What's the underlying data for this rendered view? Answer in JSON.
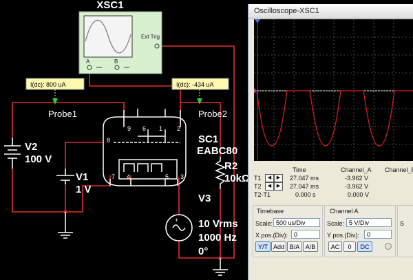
{
  "schematic": {
    "xsc_title": "XSC1",
    "ext_trig_label": "Ext Trig",
    "xsc_a_label": "A",
    "xsc_b_label": "B",
    "probe1_reading": "I(dc): 800 uA",
    "probe2_reading": "I(dc): -434 uA",
    "probe1_name": "Probe1",
    "probe2_name": "Probe2",
    "v2_name": "V2",
    "v2_value": "100 V",
    "v1_name": "V1",
    "v1_value": "1 V",
    "tube_ref": "SC1",
    "tube_model": "EABC80",
    "r2_name": "R2",
    "r2_value": "10kΩ",
    "v3_name": "V3",
    "v3_amp": "10 Vrms",
    "v3_freq": "1000 Hz",
    "v3_phase": "0°",
    "pins": [
      "9",
      "6",
      "1",
      "2",
      "8",
      "7",
      "4",
      "5",
      "3"
    ]
  },
  "oscilloscope": {
    "window_title": "Oscilloscope-XSC1",
    "readout": {
      "headers": [
        "Time",
        "Channel_A",
        "Channel_B"
      ],
      "rows": [
        {
          "label": "T1",
          "time": "27.047 ms",
          "a": "-3.962 V"
        },
        {
          "label": "T2",
          "time": "27.047 ms",
          "a": "-3.962 V"
        },
        {
          "label": "T2-T1",
          "time": "0.000 s",
          "a": "0.000 V"
        }
      ]
    },
    "timebase": {
      "title": "Timebase",
      "scale_label": "Scale:",
      "scale_value": "500 us/Div",
      "xpos_label": "X pos.(Div):",
      "xpos_value": "0",
      "buttons": [
        "Y/T",
        "Add",
        "B/A",
        "A/B"
      ]
    },
    "channel_a": {
      "title": "Channel A",
      "scale_label": "Scale:",
      "scale_value": "5  V/Div",
      "ypos_label": "Y pos.(Div):",
      "ypos_value": "0",
      "buttons": [
        "AC",
        "0",
        "DC"
      ]
    },
    "channel_b": {
      "scale_label": "S"
    }
  },
  "colors": {
    "wire": "#e03030",
    "trace_a": "#cc1f1f",
    "trace_b": "#f0f0f0",
    "grid": "#606060",
    "probe_flag": "#fff9b0",
    "probe_arrow": "#33cc33"
  }
}
